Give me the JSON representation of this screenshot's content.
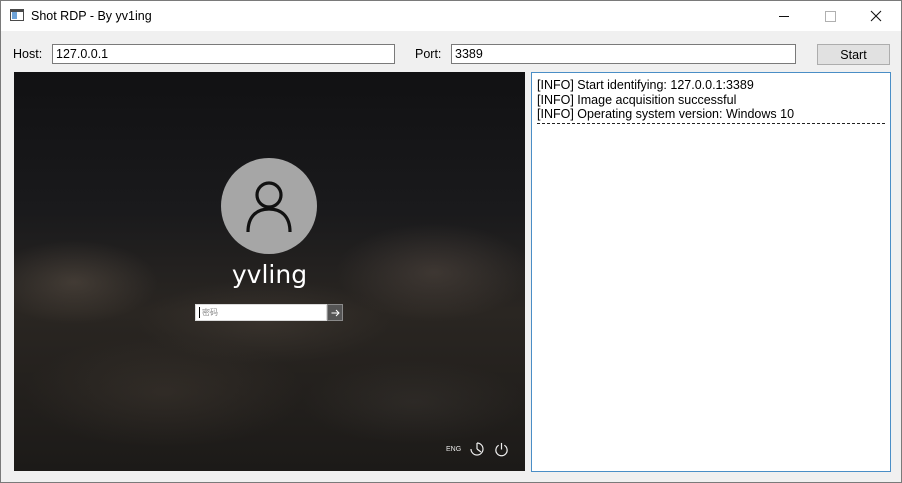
{
  "window": {
    "title": "Shot RDP - By yv1ing",
    "controls": {
      "minimize": "minimize",
      "maximize": "maximize",
      "close": "close"
    }
  },
  "form": {
    "host_label": "Host:",
    "host_value": "127.0.0.1",
    "port_label": "Port:",
    "port_value": "3389",
    "start_label": "Start"
  },
  "lockscreen": {
    "username": "yvling",
    "password_placeholder": "密码",
    "language_indicator": "ENG",
    "icons": [
      "user-avatar-icon",
      "arrow-right-icon",
      "ease-of-access-icon",
      "power-icon"
    ]
  },
  "log": {
    "lines": [
      "[INFO] Start identifying: 127.0.0.1:3389",
      "[INFO] Image acquisition successful",
      "[INFO] Operating system version: Windows 10"
    ]
  },
  "colors": {
    "window_bg": "#f0f0f0",
    "log_border": "#4a8ec6",
    "avatar_bg": "#a6a6a6"
  }
}
